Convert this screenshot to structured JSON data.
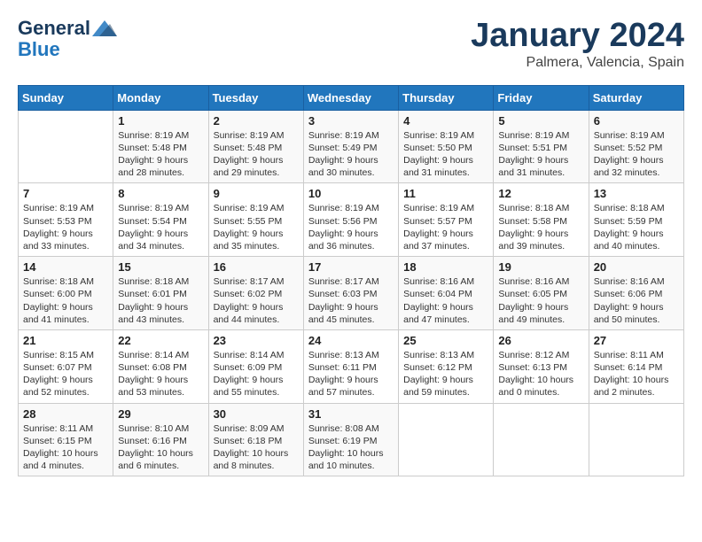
{
  "header": {
    "logo_line1": "General",
    "logo_line2": "Blue",
    "month": "January 2024",
    "location": "Palmera, Valencia, Spain"
  },
  "weekdays": [
    "Sunday",
    "Monday",
    "Tuesday",
    "Wednesday",
    "Thursday",
    "Friday",
    "Saturday"
  ],
  "weeks": [
    [
      {
        "day": "",
        "text": ""
      },
      {
        "day": "1",
        "text": "Sunrise: 8:19 AM\nSunset: 5:48 PM\nDaylight: 9 hours\nand 28 minutes."
      },
      {
        "day": "2",
        "text": "Sunrise: 8:19 AM\nSunset: 5:48 PM\nDaylight: 9 hours\nand 29 minutes."
      },
      {
        "day": "3",
        "text": "Sunrise: 8:19 AM\nSunset: 5:49 PM\nDaylight: 9 hours\nand 30 minutes."
      },
      {
        "day": "4",
        "text": "Sunrise: 8:19 AM\nSunset: 5:50 PM\nDaylight: 9 hours\nand 31 minutes."
      },
      {
        "day": "5",
        "text": "Sunrise: 8:19 AM\nSunset: 5:51 PM\nDaylight: 9 hours\nand 31 minutes."
      },
      {
        "day": "6",
        "text": "Sunrise: 8:19 AM\nSunset: 5:52 PM\nDaylight: 9 hours\nand 32 minutes."
      }
    ],
    [
      {
        "day": "7",
        "text": "Sunrise: 8:19 AM\nSunset: 5:53 PM\nDaylight: 9 hours\nand 33 minutes."
      },
      {
        "day": "8",
        "text": "Sunrise: 8:19 AM\nSunset: 5:54 PM\nDaylight: 9 hours\nand 34 minutes."
      },
      {
        "day": "9",
        "text": "Sunrise: 8:19 AM\nSunset: 5:55 PM\nDaylight: 9 hours\nand 35 minutes."
      },
      {
        "day": "10",
        "text": "Sunrise: 8:19 AM\nSunset: 5:56 PM\nDaylight: 9 hours\nand 36 minutes."
      },
      {
        "day": "11",
        "text": "Sunrise: 8:19 AM\nSunset: 5:57 PM\nDaylight: 9 hours\nand 37 minutes."
      },
      {
        "day": "12",
        "text": "Sunrise: 8:18 AM\nSunset: 5:58 PM\nDaylight: 9 hours\nand 39 minutes."
      },
      {
        "day": "13",
        "text": "Sunrise: 8:18 AM\nSunset: 5:59 PM\nDaylight: 9 hours\nand 40 minutes."
      }
    ],
    [
      {
        "day": "14",
        "text": "Sunrise: 8:18 AM\nSunset: 6:00 PM\nDaylight: 9 hours\nand 41 minutes."
      },
      {
        "day": "15",
        "text": "Sunrise: 8:18 AM\nSunset: 6:01 PM\nDaylight: 9 hours\nand 43 minutes."
      },
      {
        "day": "16",
        "text": "Sunrise: 8:17 AM\nSunset: 6:02 PM\nDaylight: 9 hours\nand 44 minutes."
      },
      {
        "day": "17",
        "text": "Sunrise: 8:17 AM\nSunset: 6:03 PM\nDaylight: 9 hours\nand 45 minutes."
      },
      {
        "day": "18",
        "text": "Sunrise: 8:16 AM\nSunset: 6:04 PM\nDaylight: 9 hours\nand 47 minutes."
      },
      {
        "day": "19",
        "text": "Sunrise: 8:16 AM\nSunset: 6:05 PM\nDaylight: 9 hours\nand 49 minutes."
      },
      {
        "day": "20",
        "text": "Sunrise: 8:16 AM\nSunset: 6:06 PM\nDaylight: 9 hours\nand 50 minutes."
      }
    ],
    [
      {
        "day": "21",
        "text": "Sunrise: 8:15 AM\nSunset: 6:07 PM\nDaylight: 9 hours\nand 52 minutes."
      },
      {
        "day": "22",
        "text": "Sunrise: 8:14 AM\nSunset: 6:08 PM\nDaylight: 9 hours\nand 53 minutes."
      },
      {
        "day": "23",
        "text": "Sunrise: 8:14 AM\nSunset: 6:09 PM\nDaylight: 9 hours\nand 55 minutes."
      },
      {
        "day": "24",
        "text": "Sunrise: 8:13 AM\nSunset: 6:11 PM\nDaylight: 9 hours\nand 57 minutes."
      },
      {
        "day": "25",
        "text": "Sunrise: 8:13 AM\nSunset: 6:12 PM\nDaylight: 9 hours\nand 59 minutes."
      },
      {
        "day": "26",
        "text": "Sunrise: 8:12 AM\nSunset: 6:13 PM\nDaylight: 10 hours\nand 0 minutes."
      },
      {
        "day": "27",
        "text": "Sunrise: 8:11 AM\nSunset: 6:14 PM\nDaylight: 10 hours\nand 2 minutes."
      }
    ],
    [
      {
        "day": "28",
        "text": "Sunrise: 8:11 AM\nSunset: 6:15 PM\nDaylight: 10 hours\nand 4 minutes."
      },
      {
        "day": "29",
        "text": "Sunrise: 8:10 AM\nSunset: 6:16 PM\nDaylight: 10 hours\nand 6 minutes."
      },
      {
        "day": "30",
        "text": "Sunrise: 8:09 AM\nSunset: 6:18 PM\nDaylight: 10 hours\nand 8 minutes."
      },
      {
        "day": "31",
        "text": "Sunrise: 8:08 AM\nSunset: 6:19 PM\nDaylight: 10 hours\nand 10 minutes."
      },
      {
        "day": "",
        "text": ""
      },
      {
        "day": "",
        "text": ""
      },
      {
        "day": "",
        "text": ""
      }
    ]
  ]
}
